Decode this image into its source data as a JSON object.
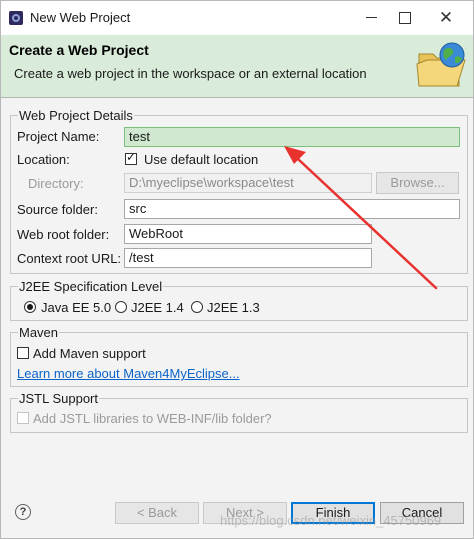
{
  "window": {
    "title": "New Web Project",
    "icon": "eclipse-app-icon",
    "controls": {
      "minimize": "minimize-icon",
      "maximize": "maximize-icon",
      "close": "✕"
    }
  },
  "banner": {
    "title": "Create a Web Project",
    "description": "Create a web project in the workspace or an external location",
    "icon": "web-folder-icon"
  },
  "details": {
    "group_title": "Web Project Details",
    "project_name_label": "Project Name:",
    "project_name_value": "test",
    "location_label": "Location:",
    "use_default_label": "Use default location",
    "use_default_checked": true,
    "directory_label": "Directory:",
    "directory_value": "D:\\myeclipse\\workspace\\test",
    "browse_label": "Browse...",
    "source_folder_label": "Source folder:",
    "source_folder_value": "src",
    "web_root_label": "Web root folder:",
    "web_root_value": "WebRoot",
    "context_root_label": "Context root URL:",
    "context_root_value": "/test"
  },
  "j2ee": {
    "group_title": "J2EE Specification Level",
    "options": [
      "Java EE 5.0",
      "J2EE 1.4",
      "J2EE 1.3"
    ],
    "selected": "Java EE 5.0"
  },
  "maven": {
    "group_title": "Maven",
    "add_support_label": "Add Maven support",
    "add_support_checked": false,
    "learn_more_link": "Learn more about Maven4MyEclipse..."
  },
  "jstl": {
    "group_title": "JSTL Support",
    "add_jstl_label": "Add JSTL libraries to WEB-INF/lib folder?",
    "add_jstl_checked": false
  },
  "footer": {
    "help": "?",
    "back_label": "< Back",
    "next_label": "Next >",
    "finish_label": "Finish",
    "cancel_label": "Cancel"
  },
  "watermark": "https://blog.csdn.net/weixin_45750969",
  "colors": {
    "banner_bg": "#d9ecd9",
    "highlight_field": "#cfe8cf",
    "annotation_arrow": "#e8322e",
    "link": "#0b63c9",
    "default_button_border": "#0078d7"
  }
}
